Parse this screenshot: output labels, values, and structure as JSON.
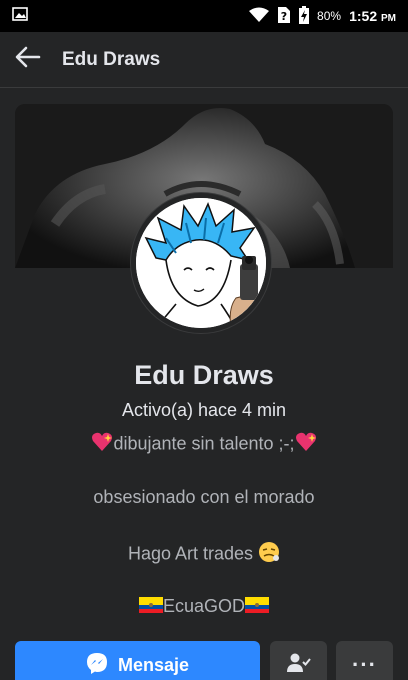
{
  "status_bar": {
    "battery": "80%",
    "time": "1:52",
    "period": "PM",
    "icons": [
      "image-icon",
      "wifi-icon",
      "sim-unknown-icon",
      "battery-charging-icon"
    ]
  },
  "app_bar": {
    "back_icon": "arrow-left-icon",
    "title": "Edu Draws"
  },
  "profile": {
    "name": "Edu Draws",
    "active_status": "Activo(a) hace 4 min",
    "bio": {
      "line1_text": "dibujante sin talento ;-;",
      "line2_text": "obsesionado con el morado",
      "line3_text": "Hago Art trades",
      "line4_text": "EcuaGOD"
    }
  },
  "actions": {
    "message_label": "Mensaje",
    "message_icon": "messenger-icon",
    "friend_icon": "friend-check-icon",
    "more_label": "···"
  },
  "colors": {
    "background": "#242526",
    "primary": "#2d88ff",
    "secondary_button": "#3a3b3c",
    "text_primary": "#e4e6eb",
    "text_secondary": "#b0b3b8"
  }
}
